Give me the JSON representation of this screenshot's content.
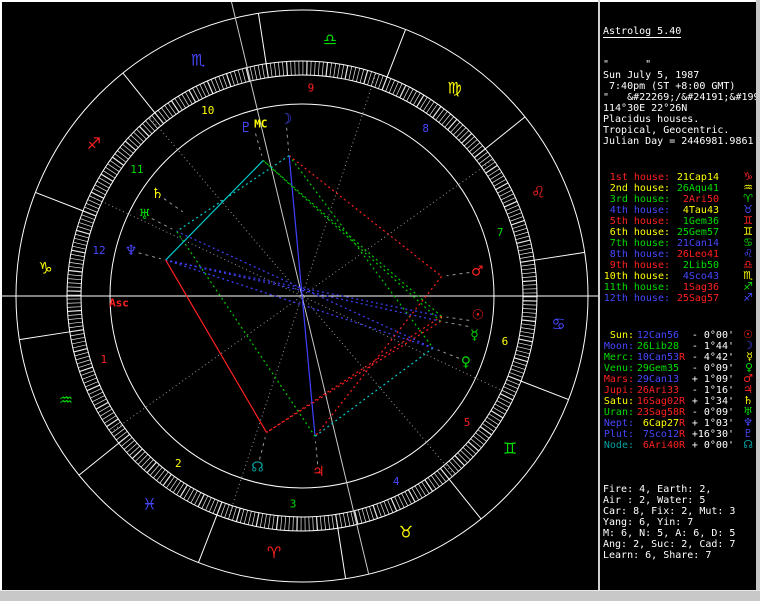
{
  "palette": {
    "red": "#ff2020",
    "yellow": "#ffff00",
    "green": "#00dd00",
    "blue": "#4747ff",
    "teal": "#00a0a0",
    "white": "#ffffff",
    "gray": "#999999",
    "axis_gray": "#c8c8c8",
    "ring_white": "#e8e8e8"
  },
  "header": {
    "title": "Astrolog 5.40",
    "lines": [
      "\"      \"",
      "Sun July 5, 1987",
      " 7:40pm (ST +8:00 GMT)",
      "\"   &#22269;/&#24191;&#199",
      "114°30E 22°26N",
      "Placidus houses.",
      "Tropical, Geocentric.",
      "Julian Day = 2446981.9861"
    ]
  },
  "houses": [
    {
      "label": "1st house:",
      "value": "21Cap14",
      "label_color": "red",
      "value_color": "yellow",
      "glyph": "♑",
      "glyph_color": "red",
      "cusp_lon": 291.233
    },
    {
      "label": "2nd house:",
      "value": "26Aqu41",
      "label_color": "yellow",
      "value_color": "green",
      "glyph": "♒",
      "glyph_color": "yellow",
      "cusp_lon": 326.683
    },
    {
      "label": "3rd house:",
      "value": "2Ari50",
      "label_color": "green",
      "value_color": "red",
      "glyph": "♈",
      "glyph_color": "green",
      "cusp_lon": 2.833
    },
    {
      "label": "4th house:",
      "value": "4Tau43",
      "label_color": "blue",
      "value_color": "yellow",
      "glyph": "♉",
      "glyph_color": "blue",
      "cusp_lon": 34.717
    },
    {
      "label": "5th house:",
      "value": "1Gem36",
      "label_color": "red",
      "value_color": "green",
      "glyph": "♊",
      "glyph_color": "red",
      "cusp_lon": 61.6
    },
    {
      "label": "6th house:",
      "value": "25Gem57",
      "label_color": "yellow",
      "value_color": "green",
      "glyph": "♊",
      "glyph_color": "yellow",
      "cusp_lon": 85.95
    },
    {
      "label": "7th house:",
      "value": "21Can14",
      "label_color": "green",
      "value_color": "blue",
      "glyph": "♋",
      "glyph_color": "green",
      "cusp_lon": 111.233
    },
    {
      "label": "8th house:",
      "value": "26Leo41",
      "label_color": "blue",
      "value_color": "red",
      "glyph": "♌",
      "glyph_color": "blue",
      "cusp_lon": 146.683
    },
    {
      "label": "9th house:",
      "value": "2Lib50",
      "label_color": "red",
      "value_color": "green",
      "glyph": "♎",
      "glyph_color": "red",
      "cusp_lon": 182.833
    },
    {
      "label": "10th house:",
      "value": "4Sco43",
      "label_color": "yellow",
      "value_color": "blue",
      "glyph": "♏",
      "glyph_color": "yellow",
      "cusp_lon": 214.717
    },
    {
      "label": "11th house:",
      "value": "1Sag36",
      "label_color": "green",
      "value_color": "red",
      "glyph": "♐",
      "glyph_color": "green",
      "cusp_lon": 241.6
    },
    {
      "label": "12th house:",
      "value": "25Sag57",
      "label_color": "blue",
      "value_color": "red",
      "glyph": "♐",
      "glyph_color": "blue",
      "cusp_lon": 265.95
    }
  ],
  "planets": [
    {
      "name": "Sun:",
      "value": "12Can56",
      "retro": false,
      "delta": "- 0°00'",
      "name_color": "yellow",
      "value_color": "blue",
      "glyph": "☉",
      "glyph_color": "red",
      "wheel_glyph_color": "red",
      "lon": 102.933,
      "wheel_offset": 2.0
    },
    {
      "name": "Moon:",
      "value": "26Lib28",
      "retro": false,
      "delta": "- 1°44'",
      "name_color": "blue",
      "value_color": "green",
      "glyph": "☽",
      "glyph_color": "blue",
      "wheel_glyph_color": "blue",
      "lon": 206.467,
      "wheel_offset": 0
    },
    {
      "name": "Merc:",
      "value": "10Can53",
      "retro": true,
      "delta": "- 4°42'",
      "name_color": "green",
      "value_color": "blue",
      "glyph": "☿",
      "glyph_color": "yellow",
      "wheel_glyph_color": "green",
      "lon": 100.883,
      "wheel_offset": -2.5
    },
    {
      "name": "Venu:",
      "value": "29Gem35",
      "retro": false,
      "delta": "- 0°09'",
      "name_color": "green",
      "value_color": "green",
      "glyph": "♀",
      "glyph_color": "green",
      "wheel_glyph_color": "green",
      "lon": 89.583,
      "wheel_offset": -0.5
    },
    {
      "name": "Mars:",
      "value": "29Can13",
      "retro": false,
      "delta": "+ 1°09'",
      "name_color": "red",
      "value_color": "blue",
      "glyph": "♂",
      "glyph_color": "red",
      "wheel_glyph_color": "red",
      "lon": 119.217,
      "wheel_offset": 0
    },
    {
      "name": "Jupi:",
      "value": "26Ari33",
      "retro": false,
      "delta": "- 1°16'",
      "name_color": "red",
      "value_color": "red",
      "glyph": "♃",
      "glyph_color": "red",
      "wheel_glyph_color": "red",
      "lon": 26.55,
      "wheel_offset": 0
    },
    {
      "name": "Satu:",
      "value": "16Sag02",
      "retro": true,
      "delta": "+ 1°34'",
      "name_color": "yellow",
      "value_color": "red",
      "glyph": "♄",
      "glyph_color": "yellow",
      "wheel_glyph_color": "yellow",
      "lon": 256.033,
      "wheel_offset": 0
    },
    {
      "name": "Uran:",
      "value": "23Sag58",
      "retro": true,
      "delta": "- 0°09'",
      "name_color": "green",
      "value_color": "red",
      "glyph": "♅",
      "glyph_color": "green",
      "wheel_glyph_color": "green",
      "lon": 263.967,
      "wheel_offset": 0
    },
    {
      "name": "Nept:",
      "value": "6Cap27",
      "retro": true,
      "delta": "+ 1°03'",
      "name_color": "blue",
      "value_color": "yellow",
      "glyph": "♆",
      "glyph_color": "blue",
      "wheel_glyph_color": "blue",
      "lon": 276.45,
      "wheel_offset": 0
    },
    {
      "name": "Plut:",
      "value": "7Sco12",
      "retro": true,
      "delta": "+16°30'",
      "name_color": "blue",
      "value_color": "blue",
      "glyph": "♇",
      "glyph_color": "blue",
      "wheel_glyph_color": "blue",
      "lon": 217.2,
      "wheel_offset": 2.5
    },
    {
      "name": "Node:",
      "value": "6Ari40",
      "retro": true,
      "delta": "+ 0°00'",
      "name_color": "teal",
      "value_color": "red",
      "glyph": "☊",
      "glyph_color": "teal",
      "wheel_glyph_color": "teal",
      "lon": 6.667,
      "wheel_offset": 0
    }
  ],
  "stats": [
    "Fire: 4, Earth: 2,",
    "Air : 2, Water: 5",
    "Car: 8, Fix: 2, Mut: 3",
    "Yang: 6, Yin: 7",
    "M: 6, N: 5, A: 6, D: 5",
    "Ang: 2, Suc: 2, Cad: 7",
    "Learn: 6, Share: 7"
  ],
  "wheel": {
    "ascendant": 291.233,
    "axis_labels": {
      "mc": "MC",
      "asc": "Asc"
    },
    "house_number_colors": [
      "red",
      "yellow",
      "green",
      "blue"
    ],
    "signs": [
      {
        "name": "Aries",
        "glyph": "♈",
        "color": "red"
      },
      {
        "name": "Taurus",
        "glyph": "♉",
        "color": "yellow"
      },
      {
        "name": "Gemini",
        "glyph": "♊",
        "color": "green"
      },
      {
        "name": "Cancer",
        "glyph": "♋",
        "color": "blue"
      },
      {
        "name": "Leo",
        "glyph": "♌",
        "color": "red"
      },
      {
        "name": "Virgo",
        "glyph": "♍",
        "color": "yellow"
      },
      {
        "name": "Libra",
        "glyph": "♎",
        "color": "green"
      },
      {
        "name": "Scorpio",
        "glyph": "♏",
        "color": "blue"
      },
      {
        "name": "Sagittarius",
        "glyph": "♐",
        "color": "red"
      },
      {
        "name": "Capricorn",
        "glyph": "♑",
        "color": "yellow"
      },
      {
        "name": "Aquarius",
        "glyph": "♒",
        "color": "green"
      },
      {
        "name": "Pisces",
        "glyph": "♓",
        "color": "blue"
      }
    ],
    "aspects": [
      {
        "name": "conjunction",
        "angle": 0,
        "orb": 7,
        "color": "#cccc00"
      },
      {
        "name": "sextile",
        "angle": 60,
        "orb": 6,
        "color": "#00cccc"
      },
      {
        "name": "square",
        "angle": 90,
        "orb": 7,
        "color": "#ff2020"
      },
      {
        "name": "trine",
        "angle": 120,
        "orb": 7,
        "color": "#00cc00"
      },
      {
        "name": "opposition",
        "angle": 180,
        "orb": 7,
        "color": "#4040ff"
      }
    ],
    "solid_orb_max": 1.0
  }
}
